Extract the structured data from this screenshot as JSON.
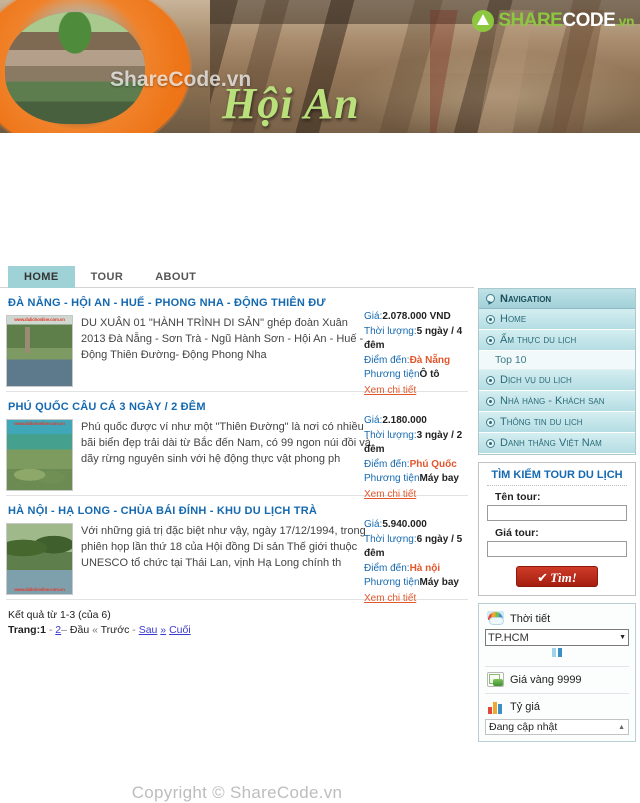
{
  "site": {
    "brand_share": "SHARE",
    "brand_code": "CODE",
    "brand_vn": ".vn",
    "hero_title": "Hội An",
    "hero_watermark": "ShareCode.vn",
    "copyright": "Copyright © ShareCode.vn"
  },
  "tabs": [
    {
      "label": "HOME",
      "active": true
    },
    {
      "label": "TOUR",
      "active": false
    },
    {
      "label": "ABOUT",
      "active": false
    }
  ],
  "tours": [
    {
      "title": "ĐÀ NẴNG - HỘI AN - HUẾ - PHONG NHA - ĐỘNG THIÊN ĐƯ",
      "description": "DU XUÂN 01 \"HÀNH TRÌNH DI SẢN\" ghép đoàn Xuân 2013 Đà Nẵng - Sơn Trà - Ngũ Hành Sơn - Hội An - Huế - Động Thiên Đường- Động Phong Nha",
      "thumb_watermark": "www.dulichonline.com.vn",
      "price_label": "Giá:",
      "price_value": "2.078.000 VND",
      "duration_label": "Thời lượng:",
      "duration_value": "5 ngày / 4 đêm",
      "destination_label": "Điểm đến:",
      "destination_value": "Đà Nẵng",
      "transport_label": "Phương tiện",
      "transport_value": "Ô tô",
      "detail_link": "Xem chi tiết"
    },
    {
      "title": "PHÚ QUỐC CÂU CÁ 3 NGÀY / 2 ĐÊM",
      "description": "Phú quốc được ví như một \"Thiên Đường\" là nơi có nhiều bãi biển đẹp trải dài từ Bắc đến Nam, có 99 ngon núi đồi và dãy rừng nguyên sinh với hệ động thực vật phong ph",
      "thumb_watermark": "www.dulichonline.com.vn",
      "price_label": "Giá:",
      "price_value": "2.180.000",
      "duration_label": "Thời lượng:",
      "duration_value": "3 ngày / 2 đêm",
      "destination_label": "Điểm đến:",
      "destination_value": "Phú Quốc",
      "transport_label": "Phương tiện",
      "transport_value": "Máy bay",
      "detail_link": "Xem chi tiết"
    },
    {
      "title": "HÀ NỘI - HẠ LONG - CHÙA BÁI ĐÍNH - KHU DU LỊCH TRÀ",
      "description": "Với những giá trị đặc biệt như vậy, ngày 17/12/1994, trong phiên họp lần thứ 18 của Hội đồng Di sản Thế giới thuộc UNESCO tổ chức tại Thái Lan, vịnh Hạ Long chính th",
      "thumb_watermark": "www.dulichonline.com.vn",
      "price_label": "Giá:",
      "price_value": "5.940.000",
      "duration_label": "Thời lượng:",
      "duration_value": "6 ngày / 5 đêm",
      "destination_label": "Điểm đến:",
      "destination_value": "Hà nội",
      "transport_label": "Phương tiện",
      "transport_value": "Máy bay",
      "detail_link": "Xem chi tiết"
    }
  ],
  "paging": {
    "results": "Kết quả từ 1-3 (của 6)",
    "page_label": "Trang:",
    "current": "1",
    "page2": "2",
    "first": "Đầu",
    "prev": "Trước",
    "next": "Sau",
    "last": "Cuối",
    "dash": "–",
    "dot": "-",
    "laquo": "«",
    "raquo": "»"
  },
  "sidebar": {
    "nav_header": "Navigation",
    "nav_items": [
      {
        "label": "Home"
      },
      {
        "label": "Ẩm thực du lịch"
      },
      {
        "label": "Dịch vụ du lịch"
      },
      {
        "label": "Nhà hàng - Khách sạn"
      },
      {
        "label": "Thông tin du lịch"
      },
      {
        "label": "Danh thắng Việt Nam"
      }
    ],
    "nav_sub_top10": "Top 10",
    "search": {
      "title": "TÌM KIẾM TOUR DU LỊCH",
      "name_label": "Tên tour:",
      "name_value": "",
      "name_placeholder": "",
      "price_label": "Giá tour:",
      "price_value": "",
      "price_placeholder": "",
      "button_label": "Tìm!",
      "button_check": "✔"
    },
    "widget": {
      "weather_label": "Thời tiết",
      "weather_city": "TP.HCM",
      "gold_label": "Giá vàng 9999",
      "rate_label": "Tỷ giá",
      "rate_status": "Đang cập nhật"
    }
  },
  "colors": {
    "accent_blue": "#1569b0",
    "accent_orange": "#e2562b",
    "tab_active": "#9ed2d6",
    "sidebar_teal": "#b4dde3",
    "brand_green": "#8dc63f",
    "button_red": "#a51f10"
  }
}
